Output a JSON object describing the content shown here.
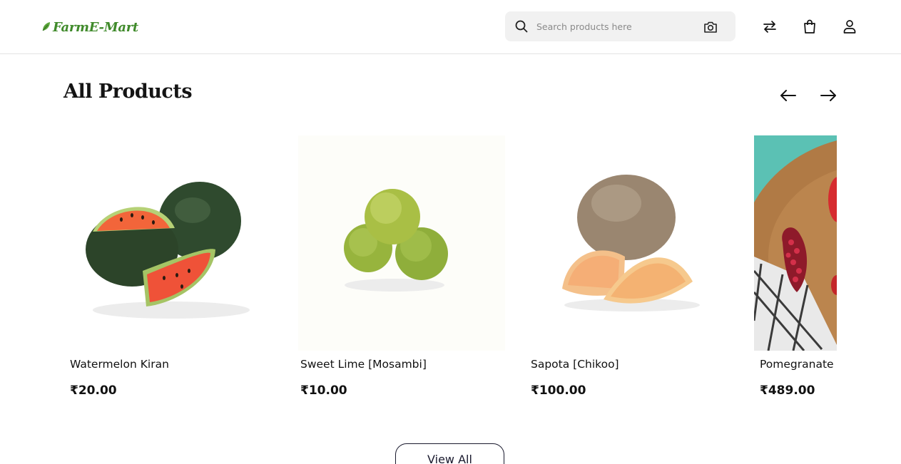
{
  "header": {
    "logo_text": "FarmE-Mart",
    "search": {
      "placeholder": "Search products here"
    },
    "icons": [
      "search-icon",
      "camera-icon",
      "compare-arrows-icon",
      "shopping-bag-icon",
      "user-icon"
    ]
  },
  "section": {
    "title": "All Products"
  },
  "products": [
    {
      "name": "Watermelon Kiran",
      "price": "₹20.00"
    },
    {
      "name": "Sweet Lime [Mosambi]",
      "price": "₹10.00"
    },
    {
      "name": "Sapota [Chikoo]",
      "price": "₹100.00"
    },
    {
      "name": "Pomegranate",
      "price": "₹489.00"
    }
  ],
  "footer": {
    "view_all_label": "View All"
  },
  "colors": {
    "brand_green": "#3f8a2a",
    "text_dark": "#111111",
    "button_border": "#1a1a2e"
  }
}
